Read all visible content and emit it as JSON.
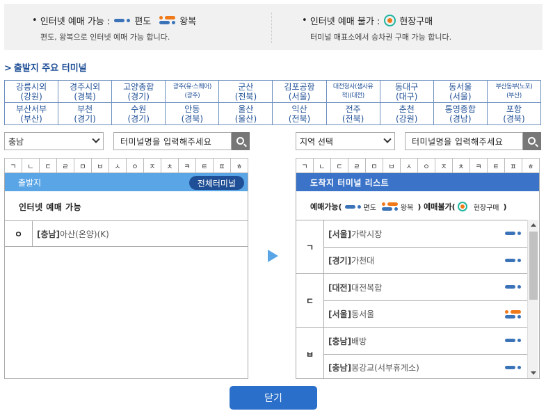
{
  "legend": {
    "online": {
      "label": "인터넷 예매 가능 :",
      "oneway": "편도",
      "round": "왕복",
      "desc": "편도, 왕복으로 인터넷 예매 가능 합니다."
    },
    "offline": {
      "label": "인터넷 예매 불가 :",
      "site": "현장구매",
      "desc": "터미널 매표소에서 승차권 구매 가능 합니다."
    }
  },
  "section_title": "출발지 주요 터미널",
  "major_terminals": [
    [
      {
        "name": "강릉시외",
        "region": "(강원)",
        "small": false
      },
      {
        "name": "경주시외",
        "region": "(경북)",
        "small": false
      },
      {
        "name": "고양종합",
        "region": "(경기)",
        "small": false
      },
      {
        "name": "광주(유·스퀘어)",
        "region": "(광주)",
        "small": true
      },
      {
        "name": "군산",
        "region": "(전북)",
        "small": false
      },
      {
        "name": "김포공항",
        "region": "(서울)",
        "small": false
      },
      {
        "name": "대전청사(샘사유",
        "region": "적)(대전)",
        "small": true
      },
      {
        "name": "동대구",
        "region": "(대구)",
        "small": false
      },
      {
        "name": "동서울",
        "region": "(서울)",
        "small": false
      },
      {
        "name": "부산동부(노포)",
        "region": "(부산)",
        "small": true
      }
    ],
    [
      {
        "name": "부산서부",
        "region": "(부산)",
        "small": false
      },
      {
        "name": "부천",
        "region": "(경기)",
        "small": false
      },
      {
        "name": "수원",
        "region": "(경기)",
        "small": false
      },
      {
        "name": "안동",
        "region": "(경북)",
        "small": false
      },
      {
        "name": "울산",
        "region": "(울산)",
        "small": false
      },
      {
        "name": "익산",
        "region": "(전북)",
        "small": false
      },
      {
        "name": "전주",
        "region": "(전북)",
        "small": false
      },
      {
        "name": "춘천",
        "region": "(강원)",
        "small": false
      },
      {
        "name": "통영종합",
        "region": "(경남)",
        "small": false
      },
      {
        "name": "포항",
        "region": "(경북)",
        "small": false
      }
    ]
  ],
  "departure_search": {
    "region": "충남",
    "placeholder": "터미널명을 입력해주세요"
  },
  "arrival_search": {
    "region": "지역 선택",
    "placeholder": "터미널명을 입력해주세요"
  },
  "consonants": [
    "ㄱ",
    "ㄴ",
    "ㄷ",
    "ㄹ",
    "ㅁ",
    "ㅂ",
    "ㅅ",
    "ㅇ",
    "ㅈ",
    "ㅊ",
    "ㅋ",
    "ㅌ",
    "ㅍ",
    "ㅎ"
  ],
  "departure": {
    "header": "출발지",
    "all_button": "전체터미널",
    "subheader": "인터넷 예매 가능",
    "rows": [
      {
        "initial": "ㅇ",
        "region": "[충남]",
        "name": "아산(온양)(K)"
      }
    ]
  },
  "arrival": {
    "header": "도착지 터미널 리스트",
    "sub": {
      "available": "예매가능(",
      "oneway": "편도",
      "round": "왕복",
      "mid": ") 예매불가(",
      "site": "현장구매",
      "end": ")"
    },
    "groups": [
      {
        "initial": "ㄱ",
        "items": [
          {
            "region": "[서울]",
            "name": "가락시장",
            "type": "oneway"
          },
          {
            "region": "[경기]",
            "name": "가천대",
            "type": "oneway"
          }
        ]
      },
      {
        "initial": "ㄷ",
        "items": [
          {
            "region": "[대전]",
            "name": "대전복합",
            "type": "oneway"
          },
          {
            "region": "[서울]",
            "name": "동서울",
            "type": "round"
          }
        ]
      },
      {
        "initial": "ㅂ",
        "items": [
          {
            "region": "[충남]",
            "name": "배방",
            "type": "oneway"
          },
          {
            "region": "[충남]",
            "name": "봉강교(서부휴게소)",
            "type": "oneway"
          }
        ]
      }
    ]
  },
  "close_label": "닫기"
}
